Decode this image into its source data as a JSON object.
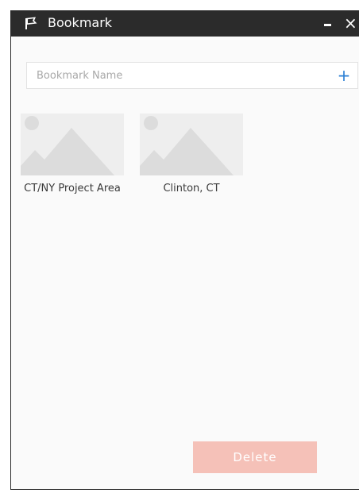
{
  "window": {
    "title": "Bookmark",
    "icon": "bookmark-ribbon-icon",
    "minimize_icon": "minimize-icon",
    "close_glyph": "×"
  },
  "search": {
    "placeholder": "Bookmark Name",
    "value": "",
    "add_glyph": "+"
  },
  "bookmarks": [
    {
      "label": "CT/NY Project Area",
      "thumbnail_icon": "image-placeholder-icon"
    },
    {
      "label": "Clinton, CT",
      "thumbnail_icon": "image-placeholder-icon"
    }
  ],
  "actions": {
    "delete_label": "Delete"
  },
  "colors": {
    "titlebar": "#2b2b2b",
    "accent": "#2b7fd4",
    "delete_disabled": "#f5c1b8",
    "panel_bg": "#fafafa"
  }
}
